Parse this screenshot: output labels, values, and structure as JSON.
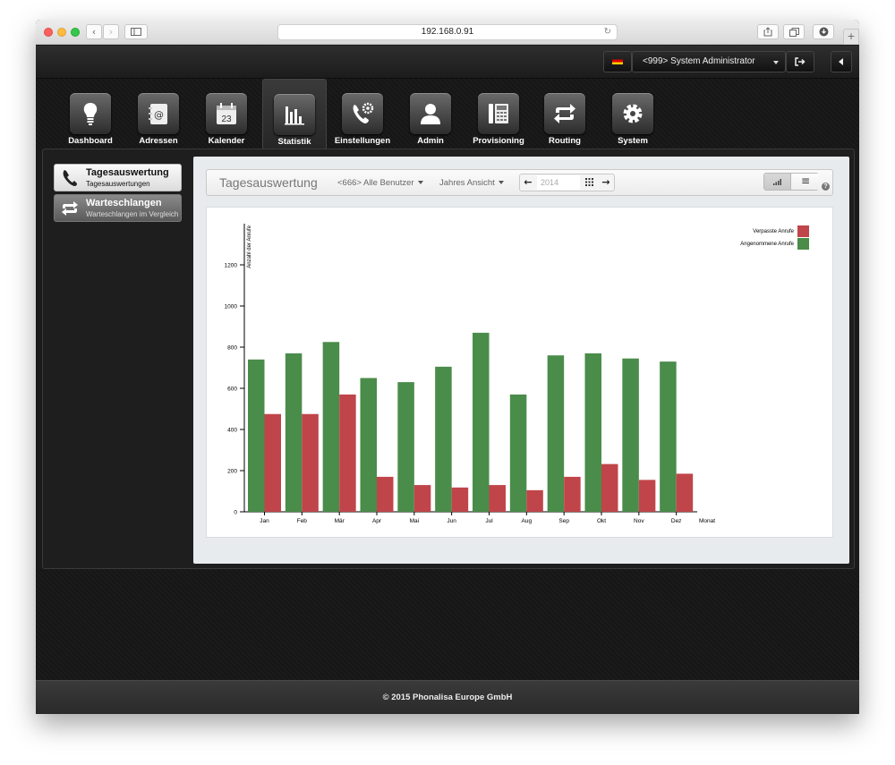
{
  "browser": {
    "url": "192.168.0.91"
  },
  "topbar": {
    "user_label": "<999> System Administrator"
  },
  "nav": {
    "items": [
      {
        "label": "Dashboard",
        "icon": "lightbulb-icon"
      },
      {
        "label": "Adressen",
        "icon": "address-book-icon"
      },
      {
        "label": "Kalender",
        "icon": "calendar-icon"
      },
      {
        "label": "Statistik",
        "icon": "bar-chart-icon",
        "active": true
      },
      {
        "label": "Einstellungen",
        "icon": "phone-settings-icon"
      },
      {
        "label": "Admin",
        "icon": "user-icon"
      },
      {
        "label": "Provisioning",
        "icon": "desk-phone-icon"
      },
      {
        "label": "Routing",
        "icon": "routing-arrows-icon"
      },
      {
        "label": "System",
        "icon": "gear-icon"
      }
    ],
    "calendar_day": "23"
  },
  "sidebar": {
    "items": [
      {
        "title": "Tagesauswertung",
        "subtitle": "Tagesauswertungen",
        "icon": "phone-icon",
        "active": true
      },
      {
        "title": "Warteschlangen",
        "subtitle": "Warteschlangen im Vergleich",
        "icon": "queue-arrows-icon",
        "active": false
      }
    ]
  },
  "toolbar": {
    "title": "Tagesauswertung",
    "user_filter": "<666> Alle Benutzer",
    "view_mode": "Jahres Ansicht",
    "year_placeholder": "2014",
    "help": "?"
  },
  "colors": {
    "accepted": "#4a8c4a",
    "missed": "#c0454a"
  },
  "chart_data": {
    "type": "bar",
    "categories": [
      "Jan",
      "Feb",
      "Mär",
      "Apr",
      "Mai",
      "Jun",
      "Jul",
      "Aug",
      "Sep",
      "Okt",
      "Nov",
      "Dez"
    ],
    "series": [
      {
        "name": "Angenommene Anrufe",
        "values": [
          740,
          770,
          825,
          650,
          630,
          705,
          870,
          570,
          760,
          770,
          745,
          730
        ]
      },
      {
        "name": "Verpasste Anrufe",
        "values": [
          475,
          475,
          570,
          170,
          130,
          118,
          130,
          105,
          170,
          232,
          155,
          185
        ]
      }
    ],
    "xlabel": "Monat",
    "ylabel": "Anzahl der Anrufe",
    "ylim": [
      0,
      1400
    ],
    "yticks": [
      0,
      200,
      400,
      600,
      800,
      1000,
      1200
    ],
    "legend": "top-right",
    "grid": false
  },
  "footer": {
    "copyright": "© 2015 Phonalisa Europe GmbH"
  }
}
